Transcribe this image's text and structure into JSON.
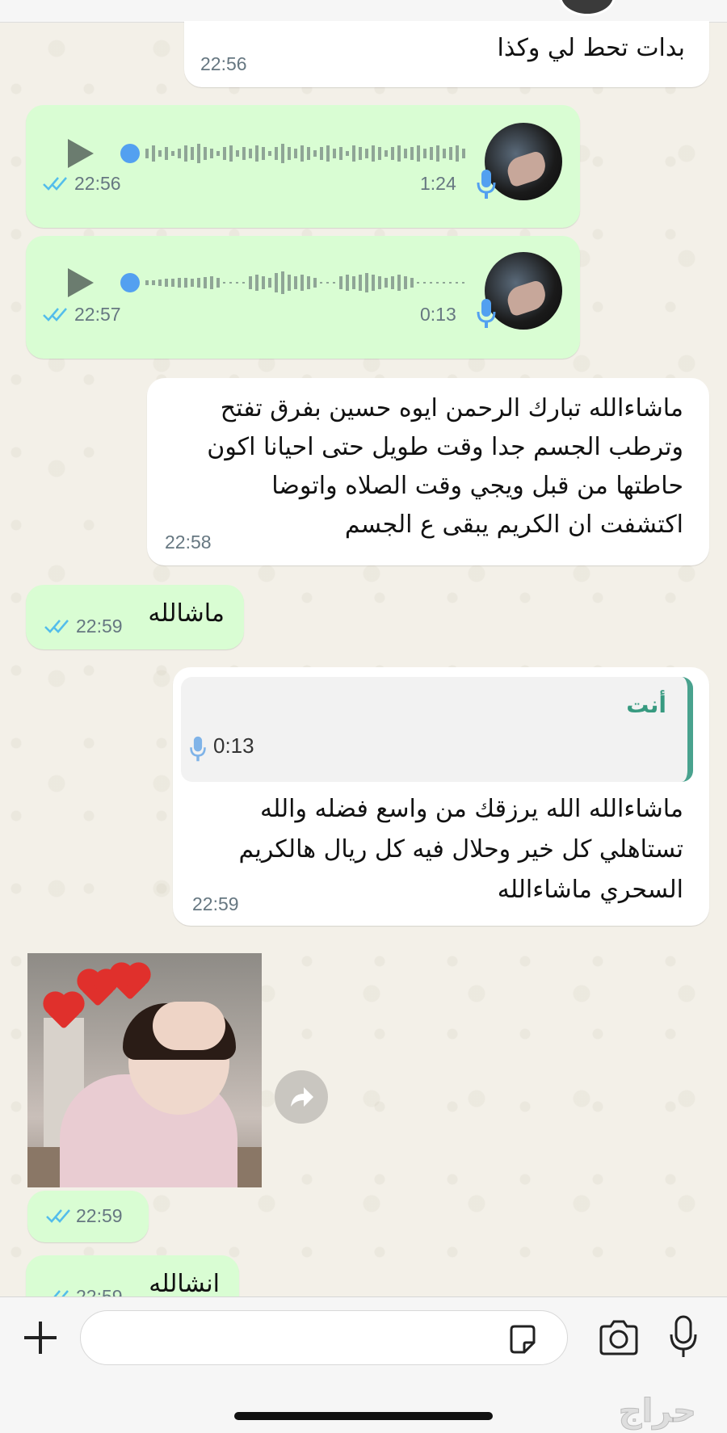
{
  "messages": [
    {
      "id": "m1",
      "direction": "incoming",
      "text": "بدات تحط لي وكذا",
      "time": "22:56"
    },
    {
      "id": "m2",
      "direction": "outgoing",
      "type": "voice",
      "duration": "1:24",
      "time": "22:56",
      "status": "read"
    },
    {
      "id": "m3",
      "direction": "outgoing",
      "type": "voice",
      "duration": "0:13",
      "time": "22:57",
      "status": "read"
    },
    {
      "id": "m4",
      "direction": "incoming",
      "lines": [
        "ماشاءالله تبارك الرحمن ايوه حسين بفرق تفتح",
        "وترطب الجسم جدا وقت طويل حتى احيانا اكون",
        "حاطتها من قبل ويجي وقت الصلاه واتوضا",
        "اكتشفت ان الكريم يبقى ع الجسم"
      ],
      "time": "22:58"
    },
    {
      "id": "m5",
      "direction": "outgoing",
      "text": "ماشالله",
      "time": "22:59",
      "status": "read"
    },
    {
      "id": "m6",
      "direction": "incoming",
      "quote": {
        "author": "أنت",
        "type": "voice",
        "duration": "0:13"
      },
      "lines": [
        "ماشاءالله الله يرزقك من واسع فضله والله",
        "تستاهلي كل خير وحلال فيه كل ريال هالكريم",
        "السحري ماشاءالله"
      ],
      "time": "22:59"
    },
    {
      "id": "m7",
      "direction": "outgoing",
      "type": "image",
      "time": "22:59",
      "status": "read"
    },
    {
      "id": "m8",
      "direction": "outgoing",
      "text": "انشالله",
      "time": "22:59",
      "status": "read"
    }
  ],
  "composer": {
    "placeholder": "",
    "icons": [
      "plus-icon",
      "sticker-icon",
      "camera-icon",
      "microphone-icon"
    ]
  },
  "colors": {
    "outgoing_bubble": "#d9fdd3",
    "incoming_bubble": "#ffffff",
    "read_ticks": "#53bdeb",
    "quote_accent": "#49a28e"
  },
  "watermark": "حراج"
}
